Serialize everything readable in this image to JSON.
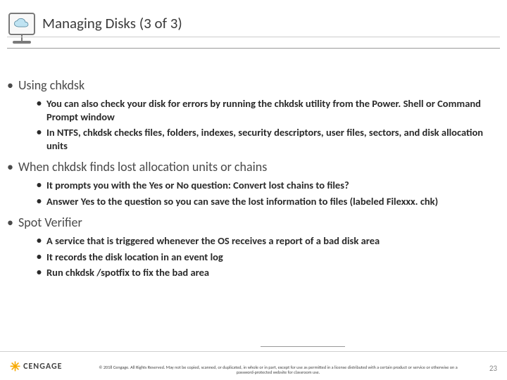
{
  "header": {
    "title": "Managing Disks (3 of 3)",
    "icon": "cloud-monitor-icon"
  },
  "content": {
    "sections": [
      {
        "heading": "Using chkdsk",
        "points": [
          "You can also check your disk for errors by running the chkdsk utility from the Power. Shell or Command Prompt window",
          "In NTFS, chkdsk checks files, folders, indexes, security descriptors, user files, sectors, and disk allocation units"
        ]
      },
      {
        "heading": "When chkdsk finds lost allocation units or chains",
        "points": [
          "It prompts you with the Yes or No question: Convert lost chains to files?",
          "Answer Yes to the question so you can save the lost information to files (labeled Filexxx. chk)"
        ]
      },
      {
        "heading": "Spot Verifier",
        "points": [
          "A service that is triggered whenever the OS receives a report of a bad disk area",
          "It records the disk location in an event log",
          "Run chkdsk /spotfix to fix the bad area"
        ]
      }
    ]
  },
  "footer": {
    "brand": "CENGAGE",
    "copyright": "© 2018 Cengage. All Rights Reserved. May not be copied, scanned, or duplicated, in whole or in part, except for use as permitted in a license distributed with a certain product or service or otherwise on a password-protected website for classroom use.",
    "page_number": "23"
  }
}
